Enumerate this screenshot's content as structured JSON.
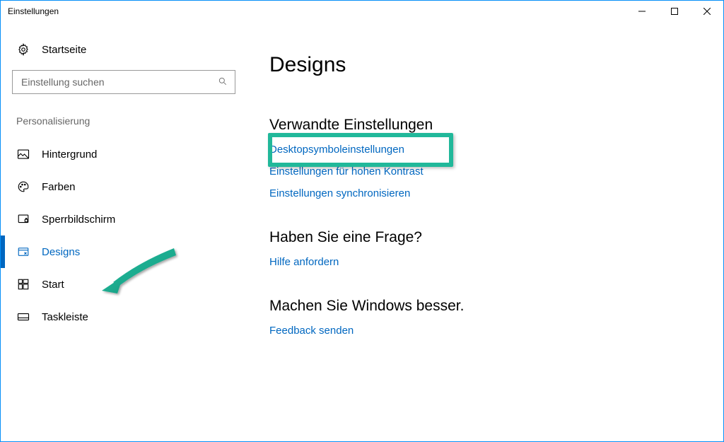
{
  "window": {
    "title": "Einstellungen"
  },
  "sidebar": {
    "home": "Startseite",
    "search_placeholder": "Einstellung suchen",
    "group": "Personalisierung",
    "items": [
      {
        "label": "Hintergrund"
      },
      {
        "label": "Farben"
      },
      {
        "label": "Sperrbildschirm"
      },
      {
        "label": "Designs"
      },
      {
        "label": "Start"
      },
      {
        "label": "Taskleiste"
      }
    ]
  },
  "main": {
    "title": "Designs",
    "sections": [
      {
        "heading": "Verwandte Einstellungen",
        "links": [
          "Desktopsymboleinstellungen",
          "Einstellungen für hohen Kontrast",
          "Einstellungen synchronisieren"
        ]
      },
      {
        "heading": "Haben Sie eine Frage?",
        "links": [
          "Hilfe anfordern"
        ]
      },
      {
        "heading": "Machen Sie Windows besser.",
        "links": [
          "Feedback senden"
        ]
      }
    ]
  },
  "annotation": {
    "highlight_target": "Desktopsymboleinstellungen",
    "arrow_target": "Designs",
    "color": "#21b89a"
  }
}
